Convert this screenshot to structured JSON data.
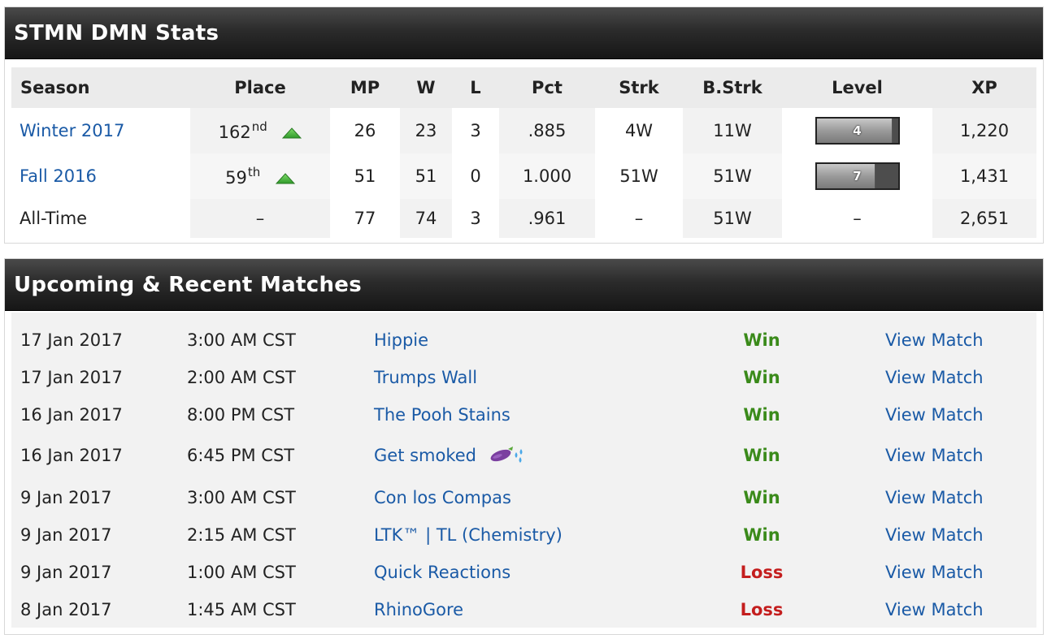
{
  "stats_panel": {
    "title": "STMN DMN Stats",
    "columns": [
      "Season",
      "Place",
      "MP",
      "W",
      "L",
      "Pct",
      "Strk",
      "B.Strk",
      "Level",
      "XP"
    ],
    "rows": [
      {
        "season": "Winter 2017",
        "place_num": "162",
        "place_suffix": "nd",
        "rank_trend": "up-arrow-icon",
        "mp": "26",
        "w": "23",
        "l": "3",
        "pct": ".885",
        "strk": "4W",
        "bstrk": "11W",
        "level": "4",
        "level_progress": 0.93,
        "xp": "1,220"
      },
      {
        "season": "Fall 2016",
        "place_num": "59",
        "place_suffix": "th",
        "rank_trend": "up-arrow-icon",
        "mp": "51",
        "w": "51",
        "l": "0",
        "pct": "1.000",
        "strk": "51W",
        "bstrk": "51W",
        "level": "7",
        "level_progress": 0.72,
        "xp": "1,431"
      },
      {
        "season": "All-Time",
        "place": "–",
        "mp": "77",
        "w": "74",
        "l": "3",
        "pct": ".961",
        "strk": "–",
        "bstrk": "51W",
        "level": "–",
        "xp": "2,651"
      }
    ]
  },
  "matches_panel": {
    "title": "Upcoming & Recent Matches",
    "view_label": "View Match",
    "matches": [
      {
        "date": "17 Jan 2017",
        "time": "3:00 AM CST",
        "opponent": "Hippie",
        "result": "Win"
      },
      {
        "date": "17 Jan 2017",
        "time": "2:00 AM CST",
        "opponent": "Trumps Wall",
        "result": "Win"
      },
      {
        "date": "16 Jan 2017",
        "time": "8:00 PM CST",
        "opponent": "The Pooh Stains",
        "result": "Win"
      },
      {
        "date": "16 Jan 2017",
        "time": "6:45 PM CST",
        "opponent": "Get smoked",
        "opponent_emoji": "eggplant-sweat-icon",
        "result": "Win"
      },
      {
        "date": "9 Jan 2017",
        "time": "3:00 AM CST",
        "opponent": "Con los Compas",
        "result": "Win"
      },
      {
        "date": "9 Jan 2017",
        "time": "2:15 AM CST",
        "opponent": "LTK™ | TL (Chemistry)",
        "result": "Win"
      },
      {
        "date": "9 Jan 2017",
        "time": "1:00 AM CST",
        "opponent": "Quick Reactions",
        "result": "Loss"
      },
      {
        "date": "8 Jan 2017",
        "time": "1:45 AM CST",
        "opponent": "RhinoGore",
        "result": "Loss"
      }
    ]
  },
  "colors": {
    "link": "#1a5aa6",
    "win": "#3a8a1a",
    "loss": "#c41e1e",
    "header_dark": "#161616",
    "arrow_green": "#3fb03a"
  }
}
